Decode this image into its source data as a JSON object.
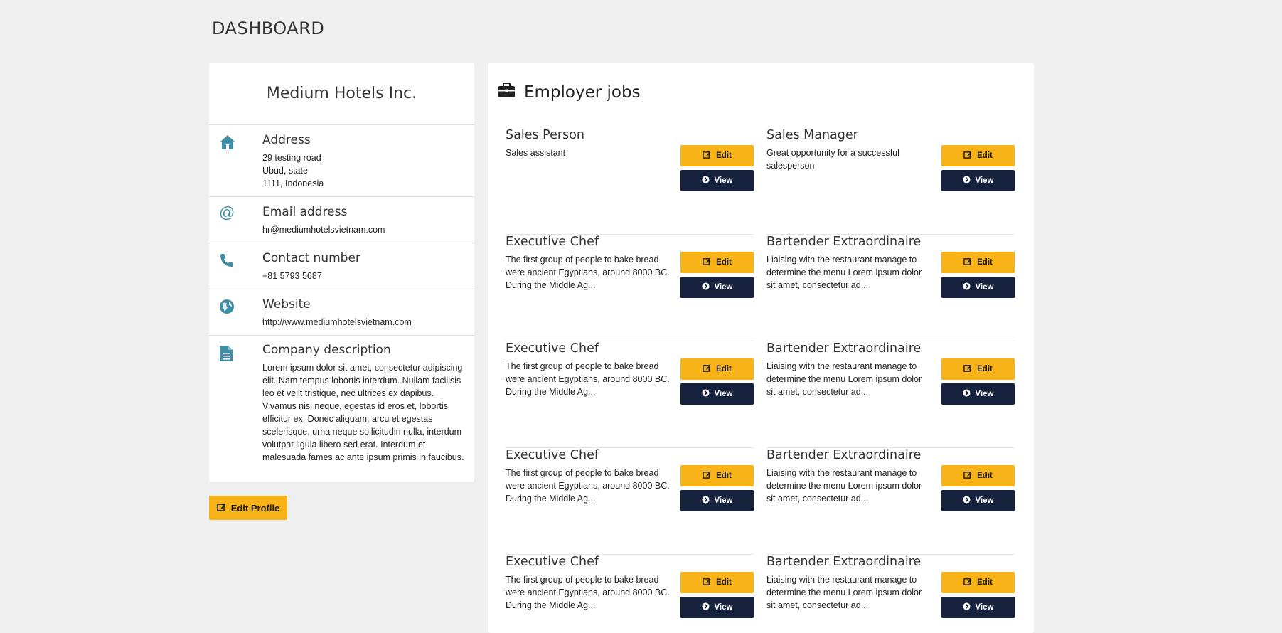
{
  "page": {
    "title": "DASHBOARD"
  },
  "profile": {
    "company_name": "Medium Hotels Inc.",
    "address": {
      "label": "Address",
      "lines": [
        "29 testing road",
        "Ubud, state",
        "1111, Indonesia"
      ]
    },
    "email": {
      "label": "Email address",
      "value": "hr@mediumhotelsvietnam.com"
    },
    "phone": {
      "label": "Contact number",
      "value": "+81 5793 5687"
    },
    "website": {
      "label": "Website",
      "value": "http://www.mediumhotelsvietnam.com"
    },
    "description": {
      "label": "Company description",
      "value": "Lorem ipsum dolor sit amet, consectetur adipiscing elit. Nam tempus lobortis interdum. Nullam facilisis leo et velit tristique, nec ultrices ex dapibus. Vivamus nisl neque, egestas id eros et, lobortis efficitur ex. Donec aliquam, arcu et egestas scelerisque, urna neque sollicitudin nulla, interdum volutpat ligula libero sed erat. Interdum et malesuada fames ac ante ipsum primis in faucibus."
    },
    "edit_profile_label": "Edit Profile"
  },
  "jobs": {
    "title": "Employer jobs",
    "edit_label": "Edit",
    "view_label": "View",
    "items": [
      {
        "title": "Sales Person",
        "desc": "Sales assistant"
      },
      {
        "title": "Sales Manager",
        "desc": "Great opportunity for a successful salesperson"
      },
      {
        "title": "Executive Chef",
        "desc": "The first group of people to bake bread were ancient Egyptians, around 8000 BC. During the Middle Ag..."
      },
      {
        "title": "Bartender Extraordinaire",
        "desc": "Liaising with the restaurant manage to determine the menu Lorem ipsum dolor sit amet, consectetur ad..."
      },
      {
        "title": "Executive Chef",
        "desc": "The first group of people to bake bread were ancient Egyptians, around 8000 BC. During the Middle Ag..."
      },
      {
        "title": "Bartender Extraordinaire",
        "desc": "Liaising with the restaurant manage to determine the menu Lorem ipsum dolor sit amet, consectetur ad..."
      },
      {
        "title": "Executive Chef",
        "desc": "The first group of people to bake bread were ancient Egyptians, around 8000 BC. During the Middle Ag..."
      },
      {
        "title": "Bartender Extraordinaire",
        "desc": "Liaising with the restaurant manage to determine the menu Lorem ipsum dolor sit amet, consectetur ad..."
      },
      {
        "title": "Executive Chef",
        "desc": "The first group of people to bake bread were ancient Egyptians, around 8000 BC. During the Middle Ag..."
      },
      {
        "title": "Bartender Extraordinaire",
        "desc": "Liaising with the restaurant manage to determine the menu Lorem ipsum dolor sit amet, consectetur ad..."
      }
    ]
  },
  "colors": {
    "background": "#efefef",
    "accent_yellow": "#f7b318",
    "navy": "#16213d",
    "icon_teal": "#3f8ea6"
  },
  "icons": {
    "address": "home-icon",
    "email": "at-sign-icon",
    "phone": "phone-icon",
    "website": "globe-icon",
    "description": "document-icon",
    "jobs": "briefcase-icon",
    "edit": "edit-icon",
    "view": "chevron-circle-right-icon"
  }
}
